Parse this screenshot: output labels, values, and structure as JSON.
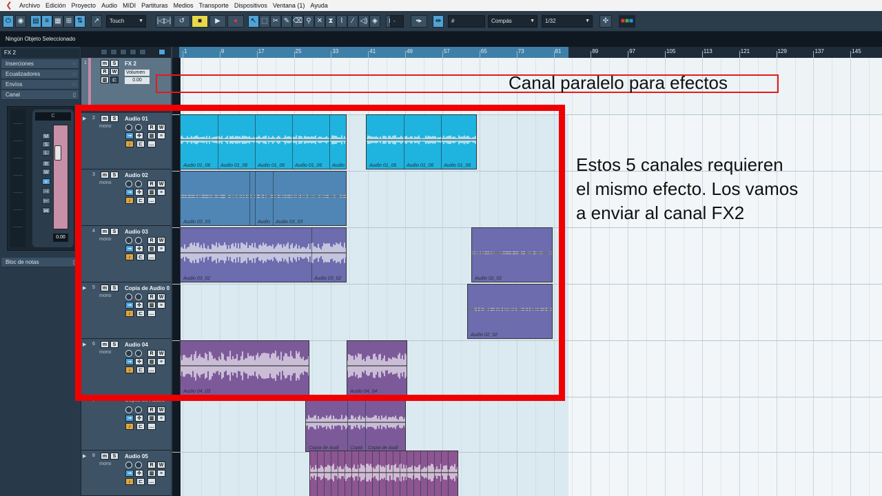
{
  "menu": [
    "Archivo",
    "Edición",
    "Proyecto",
    "Audio",
    "MIDI",
    "Partituras",
    "Medios",
    "Transporte",
    "Dispositivos",
    "Ventana (1)",
    "Ayuda"
  ],
  "toolbar": {
    "automation_mode": "Touch",
    "snap_type": "Compás",
    "quantize": "1/32",
    "nudge": "-"
  },
  "status": "Ningún Objeto Seleccionado",
  "inspector": {
    "track_name": "FX 2",
    "sections": [
      "Inserciones",
      "Ecualizadores",
      "Envíos",
      "Canal"
    ],
    "fader_value": "0.00",
    "notes_label": "Bloc de notas"
  },
  "ruler": [
    "1",
    "9",
    "17",
    "25",
    "33",
    "41",
    "49",
    "57",
    "65",
    "73",
    "81",
    "89",
    "97",
    "105",
    "113",
    "121",
    "129",
    "137",
    "145"
  ],
  "tracks": [
    {
      "num": "1",
      "name": "FX 2",
      "param": "Volumen",
      "value": "0.00"
    },
    {
      "num": "2",
      "name": "Audio 01",
      "mode": "mono"
    },
    {
      "num": "3",
      "name": "Audio 02",
      "mode": "mono"
    },
    {
      "num": "4",
      "name": "Audio 03",
      "mode": "mono"
    },
    {
      "num": "5",
      "name": "Copia de Audio 0",
      "mode": "mono"
    },
    {
      "num": "6",
      "name": "Audio 04",
      "mode": "mono"
    },
    {
      "num": "7",
      "name": "Copia de Audio",
      "mode": "mono"
    },
    {
      "num": "8",
      "name": "Audio 05",
      "mode": "mono"
    }
  ],
  "parts": {
    "a1": [
      "Audio 01_06",
      "Audio 01_06",
      "Audio 01_06",
      "Audio 01_06",
      "Audio",
      "Audio 01_06",
      "Audio 01_06",
      "Audio 01_06"
    ],
    "a2": [
      "Audio 03_03",
      "Audio",
      "Audio 03_03"
    ],
    "a3": [
      "Audio 03_02",
      "Audio 03_02",
      "Audio 02_02"
    ],
    "a4": [
      "Audio 02_02"
    ],
    "a5": [
      "Audio 04_03",
      "Audio 04_04"
    ],
    "a6": [
      "Copia de Audi",
      "Copia",
      "Copia de Audi"
    ]
  },
  "annotations": {
    "fx_channel": "Canal paralelo para efectos",
    "note_lines": [
      "Estos 5 canales requieren",
      "el mismo efecto. Los vamos",
      "a enviar al canal FX2"
    ]
  }
}
